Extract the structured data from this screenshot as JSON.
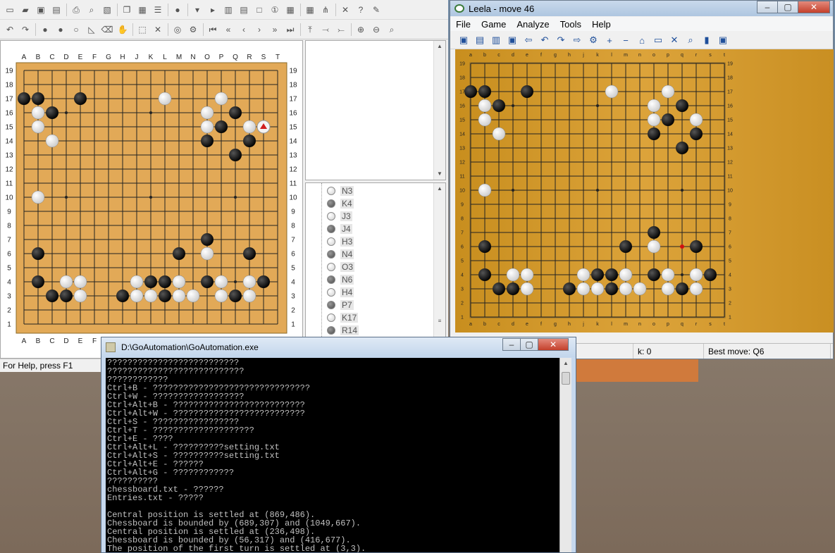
{
  "left_app": {
    "status": "For Help, press F1",
    "toolbar1": [
      "new-icon",
      "open-icon",
      "save-icon",
      "save-as-icon",
      "print-icon",
      "print-preview-icon",
      "image-icon",
      "copy-icon",
      "paste-icon",
      "properties-icon",
      "black-first-icon",
      "dropdown-icon",
      "play-icon",
      "board-view-icon",
      "column-view-icon",
      "blank-view-icon",
      "number-icon",
      "layout1-icon",
      "layout2-icon",
      "tree-icon",
      "tools-icon",
      "help-icon",
      "pen-icon"
    ],
    "toolbar2": [
      "undo-icon",
      "redo-icon",
      "black-stone-tool-icon",
      "black-dot-icon",
      "white-dot-icon",
      "triangle-tool-icon",
      "erase-icon",
      "hand-icon",
      "select-icon",
      "delete-icon",
      "circle-tool-icon",
      "gear-tool-icon",
      "first-move-icon",
      "back-fast-icon",
      "back-icon",
      "forward-icon",
      "forward-fast-icon",
      "last-move-icon",
      "branch-up-icon",
      "branch-left-icon",
      "branch-right-icon",
      "zoom-in-icon",
      "zoom-out-icon",
      "find-icon"
    ],
    "columns": [
      "A",
      "B",
      "C",
      "D",
      "E",
      "F",
      "G",
      "H",
      "J",
      "K",
      "L",
      "M",
      "N",
      "O",
      "P",
      "Q",
      "R",
      "S",
      "T"
    ],
    "rows": [
      "19",
      "18",
      "17",
      "16",
      "15",
      "14",
      "13",
      "12",
      "11",
      "10",
      "9",
      "8",
      "7",
      "6",
      "5",
      "4",
      "3",
      "2",
      "1"
    ],
    "last_move_marker": "R15",
    "tree": [
      {
        "color": "white",
        "move": "N3"
      },
      {
        "color": "black",
        "move": "K4"
      },
      {
        "color": "white",
        "move": "J3"
      },
      {
        "color": "black",
        "move": "J4"
      },
      {
        "color": "white",
        "move": "H3"
      },
      {
        "color": "black",
        "move": "N4"
      },
      {
        "color": "white",
        "move": "O3"
      },
      {
        "color": "black",
        "move": "N6"
      },
      {
        "color": "white",
        "move": "H4"
      },
      {
        "color": "black",
        "move": "P7"
      },
      {
        "color": "white",
        "move": "K17"
      },
      {
        "color": "black",
        "move": "R14"
      }
    ]
  },
  "board": {
    "black": [
      [
        0,
        16
      ],
      [
        1,
        16
      ],
      [
        4,
        16
      ],
      [
        2,
        15
      ],
      [
        15,
        15
      ],
      [
        14,
        14
      ],
      [
        13,
        13
      ],
      [
        16,
        13
      ],
      [
        15,
        12
      ],
      [
        13,
        6
      ],
      [
        1,
        5
      ],
      [
        11,
        5
      ],
      [
        16,
        5
      ],
      [
        1,
        3
      ],
      [
        9,
        3
      ],
      [
        10,
        3
      ],
      [
        11,
        3
      ],
      [
        13,
        3
      ],
      [
        17,
        3
      ],
      [
        2,
        2
      ],
      [
        3,
        2
      ],
      [
        7,
        2
      ],
      [
        10,
        2
      ],
      [
        15,
        2
      ]
    ],
    "white": [
      [
        10,
        16
      ],
      [
        14,
        16
      ],
      [
        1,
        15
      ],
      [
        13,
        15
      ],
      [
        1,
        14
      ],
      [
        13,
        14
      ],
      [
        16,
        14
      ],
      [
        2,
        13
      ],
      [
        1,
        9
      ],
      [
        13,
        5
      ],
      [
        3,
        3
      ],
      [
        4,
        3
      ],
      [
        8,
        3
      ],
      [
        11,
        3
      ],
      [
        14,
        3
      ],
      [
        16,
        3
      ],
      [
        4,
        2
      ],
      [
        8,
        2
      ],
      [
        9,
        2
      ],
      [
        11,
        2
      ],
      [
        12,
        2
      ],
      [
        14,
        2
      ],
      [
        16,
        2
      ]
    ],
    "hoshi": [
      [
        3,
        3
      ],
      [
        9,
        3
      ],
      [
        15,
        3
      ],
      [
        3,
        9
      ],
      [
        9,
        9
      ],
      [
        15,
        9
      ],
      [
        3,
        15
      ],
      [
        9,
        15
      ],
      [
        15,
        15
      ]
    ]
  },
  "leela": {
    "title": "Leela - move 46",
    "menu": [
      "File",
      "Game",
      "Analyze",
      "Tools",
      "Help"
    ],
    "toolbar": [
      "new-game-icon",
      "open-game-icon",
      "load-icon",
      "save-icon",
      "back-arrow-icon",
      "undo-icon",
      "redo-icon",
      "forward-arrow-icon",
      "settings-icon",
      "plus-icon",
      "minus-icon",
      "home-icon",
      "hash-icon",
      "cross-icon",
      "search-icon",
      "bookmark-icon",
      "engine-icon"
    ],
    "columns": [
      "a",
      "b",
      "c",
      "d",
      "e",
      "f",
      "g",
      "h",
      "j",
      "k",
      "l",
      "m",
      "n",
      "o",
      "p",
      "q",
      "r",
      "s",
      "t"
    ],
    "rows": [
      "19",
      "18",
      "17",
      "16",
      "15",
      "14",
      "13",
      "12",
      "11",
      "10",
      "9",
      "8",
      "7",
      "6",
      "5",
      "4",
      "3",
      "2",
      "1"
    ],
    "status_left": "k: 0",
    "status_best": "Best move: Q6",
    "last_move": "Q6"
  },
  "console": {
    "title": "D:\\GoAutomation\\GoAutomation.exe",
    "lines": [
      "??????????????????????????",
      "???????????????????????????",
      "????????????",
      "Ctrl+B - ???????????????????????????????",
      "Ctrl+W - ??????????????????",
      "Ctrl+Alt+B - ??????????????????????????",
      "Ctrl+Alt+W - ??????????????????????????",
      "Ctrl+S - ?????????????????",
      "Ctrl+T - ????????????????????",
      "Ctrl+E - ????",
      "Ctrl+Alt+L - ??????????setting.txt",
      "Ctrl+Alt+S - ??????????setting.txt",
      "Ctrl+Alt+E - ??????",
      "Ctrl+Alt+G - ????????????",
      "??????????",
      "chessboard.txt - ??????",
      "Entries.txt - ?????",
      "",
      "Central position is settled at (869,486).",
      "Chessboard is bounded by (689,307) and (1049,667).",
      "Central position is settled at (236,498).",
      "Chessboard is bounded by (56,317) and (416,677).",
      "The position of the first turn is settled at (3,3)."
    ]
  },
  "window_buttons": {
    "minimize": "–",
    "maximize": "▢",
    "close": "✕"
  }
}
